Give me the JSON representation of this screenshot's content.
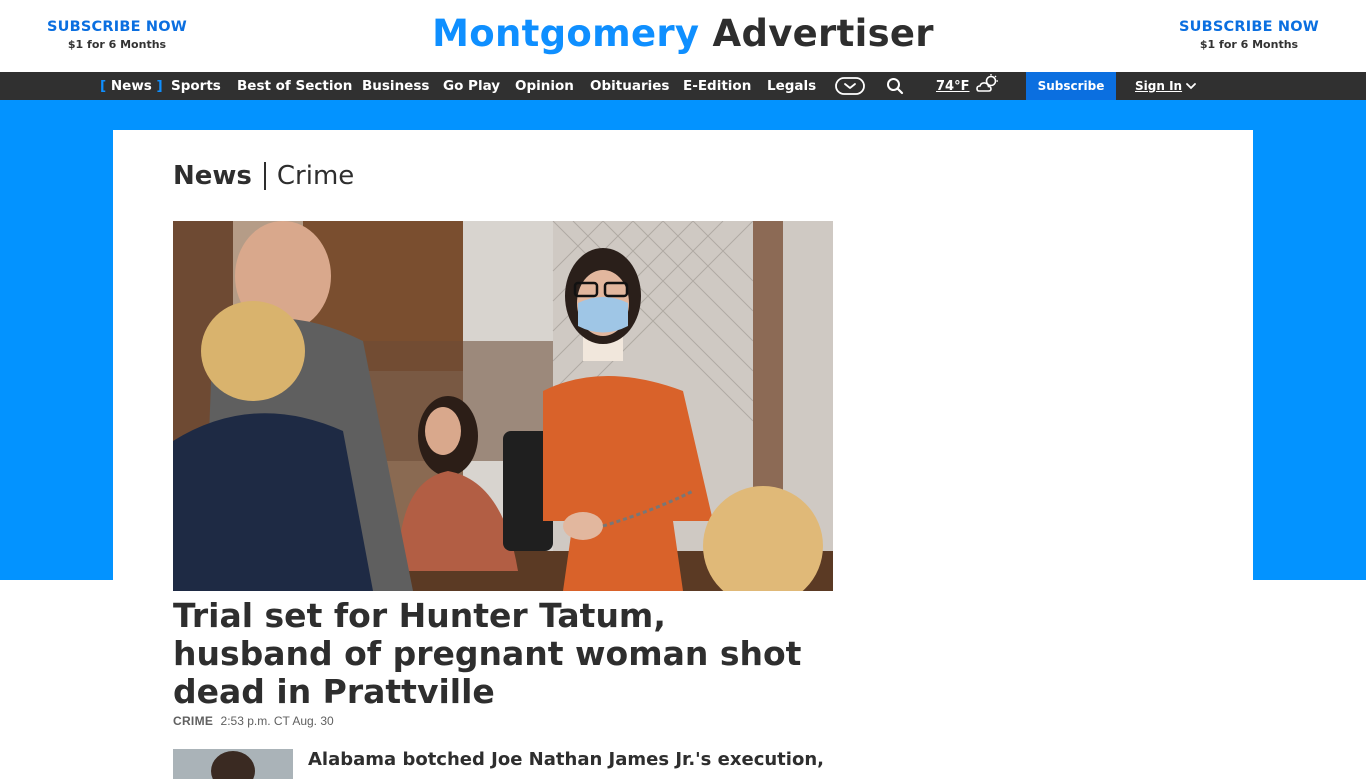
{
  "header": {
    "promo_left": {
      "title": "SUBSCRIBE NOW",
      "price": "$1 for 6 Months"
    },
    "promo_right": {
      "title": "SUBSCRIBE NOW",
      "price": "$1 for 6 Months"
    },
    "logo": {
      "part1": "Montgomery",
      "part2": "Advertiser"
    }
  },
  "nav": {
    "items": [
      {
        "label": "News",
        "active": true
      },
      {
        "label": "Sports"
      },
      {
        "label": "Best of Section"
      },
      {
        "label": "Business"
      },
      {
        "label": "Go Play"
      },
      {
        "label": "Opinion"
      },
      {
        "label": "Obituaries"
      },
      {
        "label": "E-Edition"
      },
      {
        "label": "Legals"
      }
    ],
    "active_bracket_open": "[",
    "active_bracket_close": "]",
    "weather_temp": "74°F",
    "subscribe_label": "Subscribe",
    "signin_label": "Sign In",
    "icons": [
      "more-chevron-icon",
      "search-icon",
      "partly-cloudy-icon",
      "chevron-down-icon"
    ]
  },
  "section": {
    "name": "News",
    "subsection": "Crime"
  },
  "lead_story": {
    "headline": "Trial set for Hunter Tatum, husband of pregnant woman shot dead in Prattville",
    "tag": "CRIME",
    "timestamp": "2:53 p.m. CT Aug. 30"
  },
  "second_story": {
    "headline": "Alabama botched Joe Nathan James Jr.'s execution,"
  },
  "colors": {
    "brand_blue": "#0393ff",
    "nav_bg": "#303030",
    "subscribe_blue": "#0b6fe0",
    "text_dark": "#2e2e2e"
  }
}
